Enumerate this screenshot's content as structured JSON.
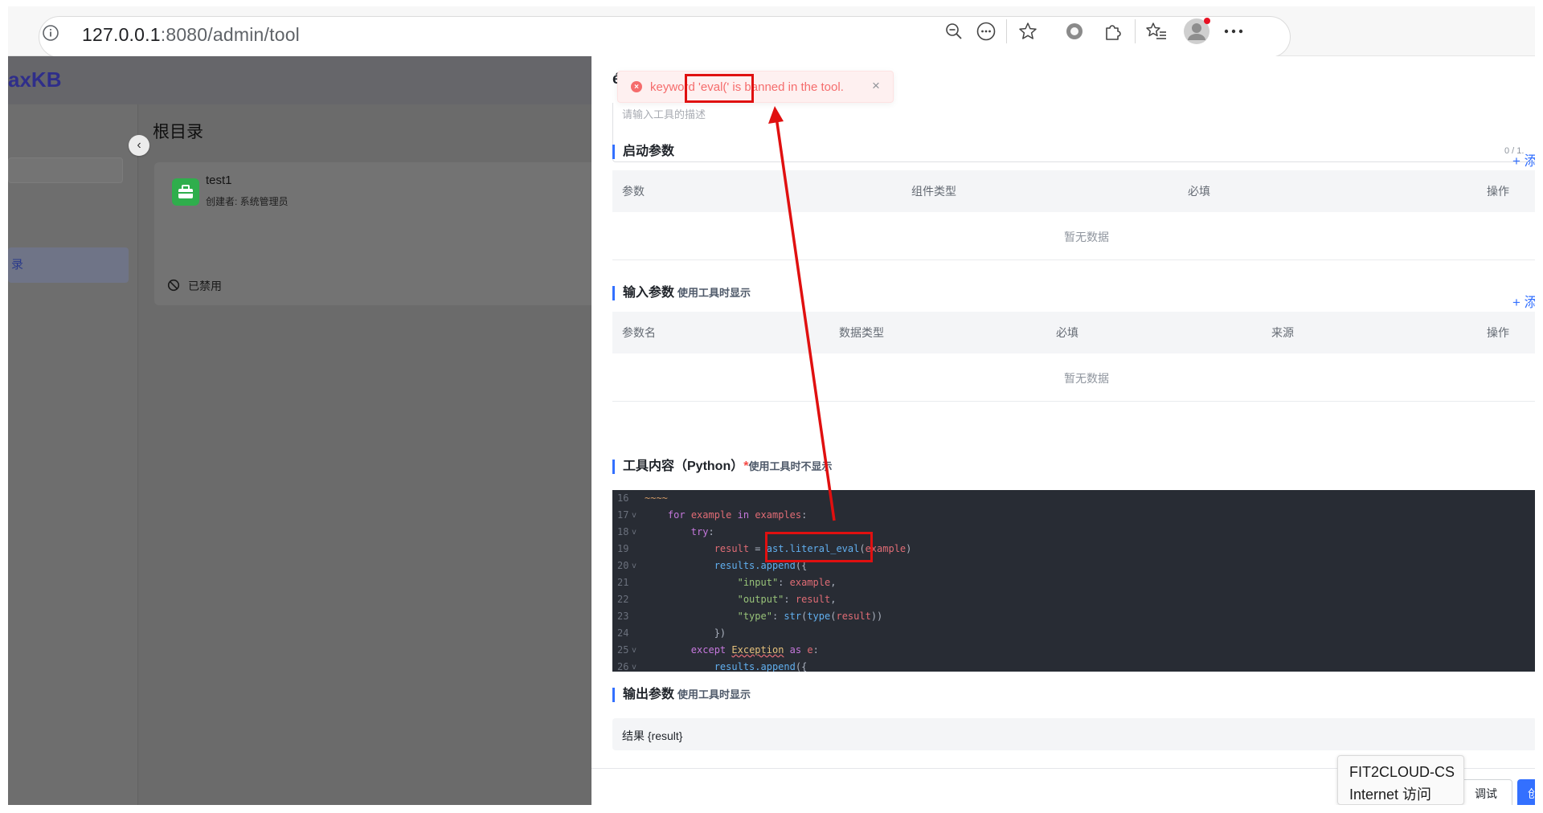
{
  "browser": {
    "url_host": "127.0.0.1",
    "url_path": ":8080/admin/tool"
  },
  "app": {
    "logo_text": "axKB",
    "sidebar_item": "录",
    "folder_title": "根目录",
    "tool_card": {
      "name": "test1",
      "creator": "创建者: 系统管理员",
      "status": "已禁用"
    }
  },
  "drawer": {
    "title_partial": "é",
    "description_placeholder": "请输入工具的描述",
    "description_count": "0 / 1.",
    "startup_params": {
      "title": "启动参数",
      "add_label": "+ 添",
      "columns": [
        "参数",
        "组件类型",
        "必填",
        "操作"
      ],
      "empty_text": "暂无数据"
    },
    "input_params": {
      "title": "输入参数",
      "subtitle": "使用工具时显示",
      "add_label": "+ 添",
      "columns": [
        "参数名",
        "数据类型",
        "必填",
        "来源",
        "操作"
      ],
      "empty_text": "暂无数据"
    },
    "tool_content": {
      "title": "工具内容（Python）",
      "required_mark": "*",
      "subtitle": "使用工具时不显示"
    },
    "output_params": {
      "title": "输出参数",
      "subtitle": "使用工具时显示",
      "row": "结果 {result}"
    },
    "buttons": {
      "debug": "调试",
      "create": "创"
    }
  },
  "code_lines": [
    {
      "n": "16",
      "fold": "",
      "text": "~~~~"
    },
    {
      "n": "17",
      "fold": "v",
      "text": "    for example in examples:"
    },
    {
      "n": "18",
      "fold": "v",
      "text": "        try:"
    },
    {
      "n": "19",
      "fold": "",
      "text": "            result = ast.literal_eval(example)"
    },
    {
      "n": "20",
      "fold": "v",
      "text": "            results.append({"
    },
    {
      "n": "21",
      "fold": "",
      "text": "                \"input\": example,"
    },
    {
      "n": "22",
      "fold": "",
      "text": "                \"output\": result,"
    },
    {
      "n": "23",
      "fold": "",
      "text": "                \"type\": str(type(result))"
    },
    {
      "n": "24",
      "fold": "",
      "text": "            })"
    },
    {
      "n": "25",
      "fold": "v",
      "text": "        except Exception as e:"
    },
    {
      "n": "26",
      "fold": "v",
      "text": "            results.append({"
    }
  ],
  "toast": {
    "message": "keyword 'eval(' is banned in the tool.",
    "close": "×"
  },
  "ime_tooltip": {
    "line1": "FIT2CLOUD-CS",
    "line2": "Internet 访问"
  },
  "colors": {
    "accent": "#3370ff",
    "error": "#f56c6c",
    "annotation": "#e01010",
    "editor_bg": "#282c34"
  }
}
